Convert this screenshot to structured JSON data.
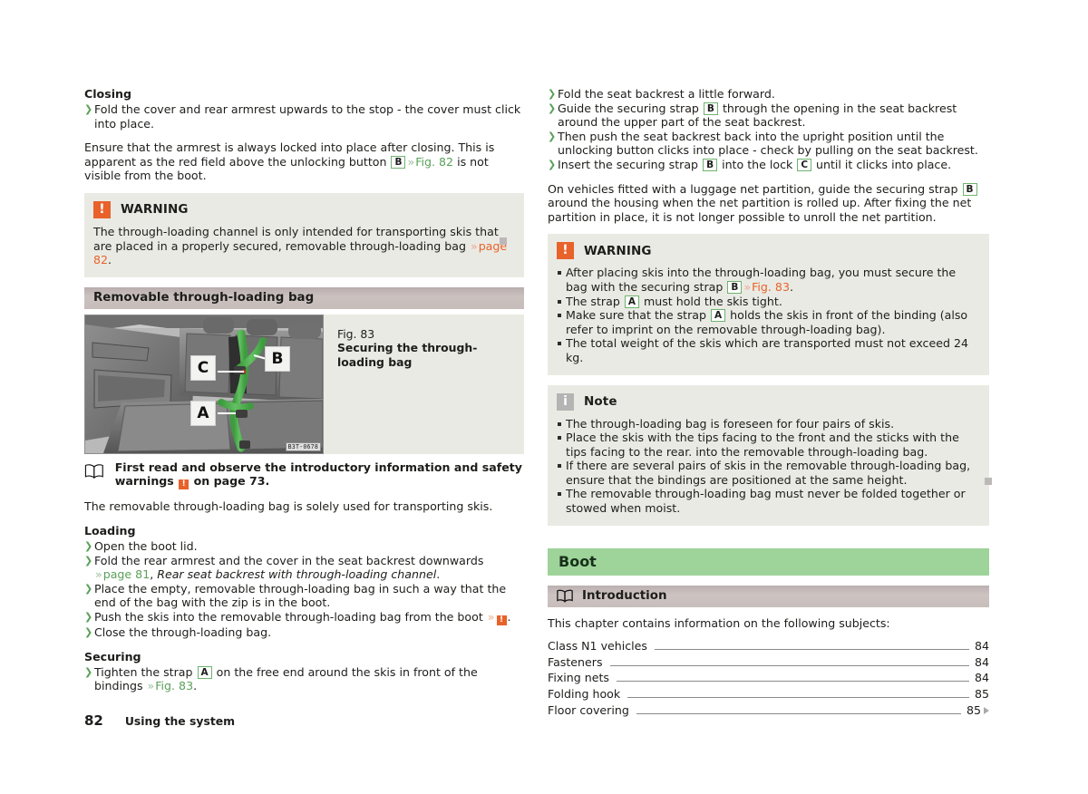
{
  "document": {
    "footer": {
      "page_number": "82",
      "section_title": "Using the system"
    }
  },
  "left_column": {
    "closing_heading": "Closing",
    "closing_steps": [
      "Fold the cover and rear armrest upwards to the stop - the cover must click into place."
    ],
    "closing_paragraph_pre": "Ensure that the armrest is always locked into place after closing. This is apparent as the red field above the unlocking button ",
    "closing_paragraph_letter": "B",
    "closing_paragraph_xref": "Fig. 82",
    "closing_paragraph_post": " is not visible from the boot.",
    "warning": {
      "icon": "warning-icon",
      "icon_glyph": "!",
      "title": "WARNING",
      "text_pre": "The through-loading channel is only intended for transporting skis that are placed in a properly secured, removable through-loading bag ",
      "xref": "page 82",
      "text_post": "."
    },
    "section_bar": "Removable through-loading bag",
    "figure": {
      "number": "Fig. 83",
      "caption": "Securing the through-loading bag",
      "image_code": "B3T-0678",
      "callouts": [
        "A",
        "B",
        "C"
      ]
    },
    "reference_note": {
      "icon": "book-icon",
      "text_pre": "First read and observe the introductory information and safety warnings ",
      "text_post": " on page 73."
    },
    "intro_paragraph": "The removable through-loading bag is solely used for transporting skis.",
    "loading_heading": "Loading",
    "loading_steps": [
      {
        "text": "Open the boot lid."
      },
      {
        "text_pre": "Fold the rear armrest and the cover in the seat backrest downwards ",
        "xref": "page 81",
        "text_mid": ", ",
        "italic": "Rear seat backrest with through-loading channel",
        "text_post": "."
      },
      {
        "text": "Place the empty, removable through-loading bag in such a way that the end of the bag with the zip is in the boot."
      },
      {
        "text_pre": "Push the skis into the removable through-loading bag from the boot ",
        "warn_glyph": "!",
        "text_post": "."
      },
      {
        "text": "Close the through-loading bag."
      }
    ],
    "securing_heading": "Securing",
    "securing_steps": [
      {
        "text_pre": "Tighten the strap ",
        "letter": "A",
        "text_mid": " on the free end around the skis in front of the bindings ",
        "xref": "Fig. 83",
        "text_post": "."
      }
    ]
  },
  "right_column": {
    "steps": [
      {
        "text": "Fold the seat backrest a little forward."
      },
      {
        "text_pre": "Guide the securing strap ",
        "letter": "B",
        "text_post": " through the opening in the seat backrest around the upper part of the seat backrest."
      },
      {
        "text": "Then push the seat backrest back into the upright position until the unlocking button clicks into place - check by pulling on the seat backrest."
      },
      {
        "text_pre": "Insert the securing strap ",
        "letter": "B",
        "text_mid": " into the lock ",
        "letter2": "C",
        "text_post": " until it clicks into place."
      }
    ],
    "net_paragraph_pre": "On vehicles fitted with a luggage net partition, guide the securing strap ",
    "net_paragraph_letter": "B",
    "net_paragraph_post": " around the housing when the net partition is rolled up. After fixing the net partition in place, it is not longer possible to unroll the net partition.",
    "warning": {
      "icon": "warning-icon",
      "icon_glyph": "!",
      "title": "WARNING",
      "items": [
        {
          "text_pre": "After placing skis into the through-loading bag, you must secure the bag with the securing strap ",
          "letter": "B",
          "xref": "Fig. 83",
          "text_post": "."
        },
        {
          "text_pre": "The strap ",
          "letter": "A",
          "text_post": " must hold the skis tight."
        },
        {
          "text_pre": "Make sure that the strap ",
          "letter": "A",
          "text_post": " holds the skis in front of the binding (also refer to imprint on the removable through-loading bag)."
        },
        {
          "text": "The total weight of the skis which are transported must not exceed 24 kg."
        }
      ]
    },
    "note": {
      "icon": "info-icon",
      "icon_glyph": "i",
      "title": "Note",
      "items": [
        {
          "text": "The through-loading bag is foreseen for four pairs of skis."
        },
        {
          "text": "Place the skis with the tips facing to the front and the sticks with the tips facing to the rear. into the removable through-loading bag."
        },
        {
          "text": "If there are several pairs of skis in the removable through-loading bag, ensure that the bindings are positioned at the same height."
        },
        {
          "text": "The removable through-loading bag must never be folded together or stowed when moist."
        }
      ]
    },
    "chapter_title": "Boot",
    "intro_bar": {
      "icon": "book-icon",
      "title": "Introduction"
    },
    "intro_lead": "This chapter contains information on the following subjects:",
    "toc": [
      {
        "label": "Class N1 vehicles",
        "page": "84",
        "arrow": false
      },
      {
        "label": "Fasteners",
        "page": "84",
        "arrow": false
      },
      {
        "label": "Fixing nets",
        "page": "84",
        "arrow": false
      },
      {
        "label": "Folding hook",
        "page": "85",
        "arrow": false
      },
      {
        "label": "Floor covering",
        "page": "85",
        "arrow": true
      }
    ]
  },
  "colors": {
    "xref_green": "#5aa05a",
    "xref_orange": "#e8622a",
    "warning_icon": "#e8622a",
    "note_icon": "#b4b4b4",
    "box_background": "#eaeae4",
    "chapter_bar": "#9ed39a",
    "subsection_bar": "#c6bcba",
    "callout_border": "#6eb36e"
  }
}
